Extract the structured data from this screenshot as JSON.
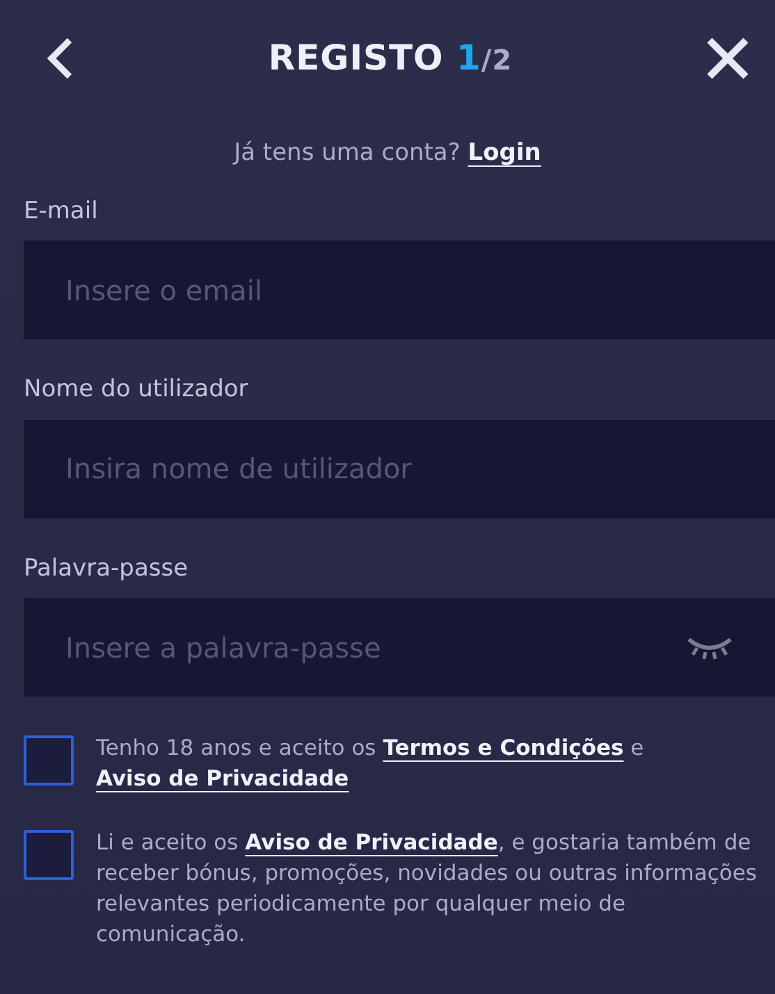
{
  "header": {
    "title": "REGISTO",
    "step": "1",
    "step_total": "/2"
  },
  "login_prompt": {
    "text": "Já tens uma conta?",
    "link": "Login"
  },
  "fields": [
    {
      "label": "E-mail",
      "placeholder": "Insere o email",
      "kind": "text"
    },
    {
      "label": "Nome do utilizador",
      "placeholder": "Insira nome de utilizador",
      "kind": "text"
    },
    {
      "label": "Palavra-passe",
      "placeholder": "Insere a palavra-passe",
      "kind": "password"
    }
  ],
  "consents": [
    {
      "checked": false,
      "parts": [
        {
          "kind": "text",
          "text": "Tenho 18 anos e aceito os "
        },
        {
          "kind": "link",
          "text": "Termos e Condições"
        },
        {
          "kind": "text",
          "text": " e "
        },
        {
          "kind": "link",
          "text": "Aviso de Privacidade"
        }
      ]
    },
    {
      "checked": false,
      "parts": [
        {
          "kind": "text",
          "text": "Li e aceito os "
        },
        {
          "kind": "link",
          "text": "Aviso de Privacidade"
        },
        {
          "kind": "text",
          "text": ", e gostaria também de receber bónus, promoções, novidades ou outras informações relevantes periodicamente por qualquer meio de comunicação."
        }
      ]
    }
  ]
}
